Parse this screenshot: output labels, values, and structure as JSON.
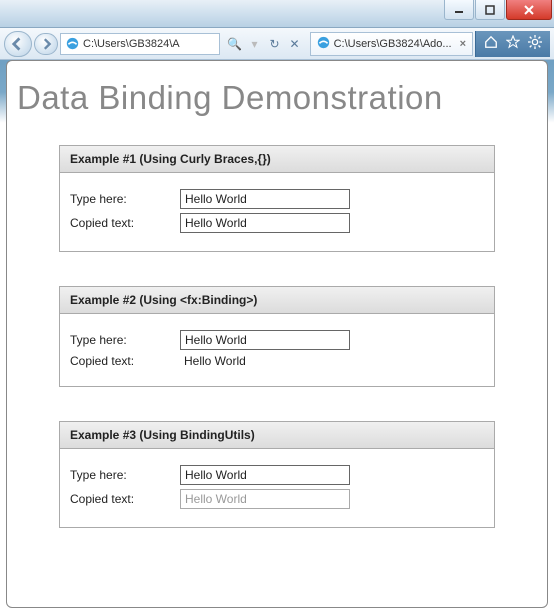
{
  "window": {
    "address_text": "C:\\Users\\GB3824\\A",
    "tab_title": "C:\\Users\\GB3824\\Ado..."
  },
  "page": {
    "title": "Data Binding Demonstration"
  },
  "panels": [
    {
      "header": "Example #1 (Using Curly Braces,{})",
      "type_label": "Type here:",
      "type_value": "Hello World",
      "copied_label": "Copied text:",
      "copied_value": "Hello World",
      "copied_render": "input"
    },
    {
      "header": "Example #2 (Using <fx:Binding>)",
      "type_label": "Type here:",
      "type_value": "Hello World",
      "copied_label": "Copied text:",
      "copied_value": "Hello World",
      "copied_render": "text"
    },
    {
      "header": "Example #3 (Using BindingUtils)",
      "type_label": "Type here:",
      "type_value": "Hello World",
      "copied_label": "Copied text:",
      "copied_value": "Hello World",
      "copied_render": "input_grey"
    }
  ]
}
